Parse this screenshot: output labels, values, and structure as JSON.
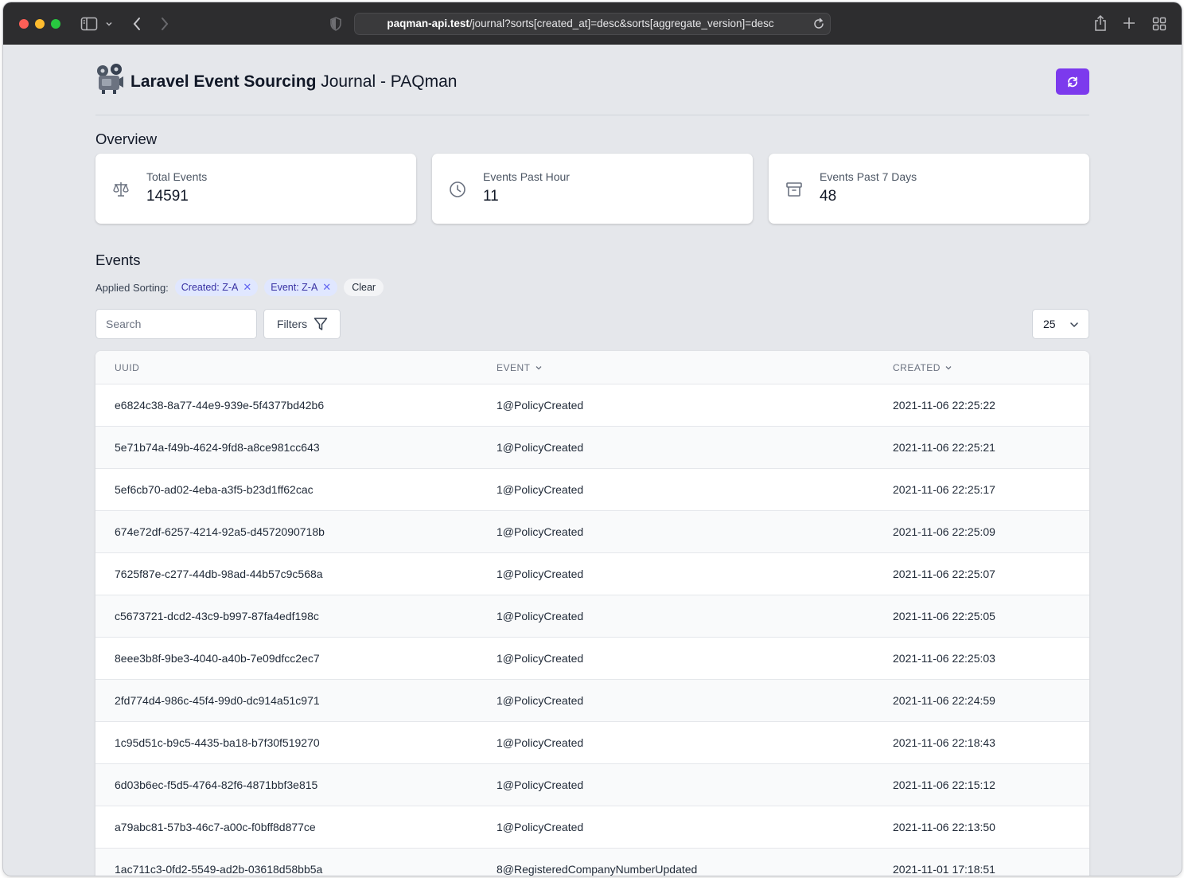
{
  "browser": {
    "url_host": "paqman-api.test",
    "url_path": "/journal?sorts[created_at]=desc&sorts[aggregate_version]=desc"
  },
  "header": {
    "title_strong": "Laravel Event Sourcing",
    "title_rest": " Journal - PAQman",
    "accent_color": "#7c3aed"
  },
  "overview": {
    "title": "Overview",
    "cards": [
      {
        "label": "Total Events",
        "value": "14591",
        "icon": "scale-icon"
      },
      {
        "label": "Events Past Hour",
        "value": "11",
        "icon": "clock-icon"
      },
      {
        "label": "Events Past 7 Days",
        "value": "48",
        "icon": "archive-icon"
      }
    ]
  },
  "events": {
    "title": "Events",
    "sorting_label": "Applied Sorting:",
    "chips": [
      "Created: Z-A",
      "Event: Z-A"
    ],
    "clear_label": "Clear",
    "search_placeholder": "Search",
    "filters_label": "Filters",
    "per_page": "25",
    "columns": [
      "UUID",
      "EVENT",
      "CREATED"
    ],
    "rows": [
      {
        "uuid": "e6824c38-8a77-44e9-939e-5f4377bd42b6",
        "event": "1@PolicyCreated",
        "created": "2021-11-06 22:25:22"
      },
      {
        "uuid": "5e71b74a-f49b-4624-9fd8-a8ce981cc643",
        "event": "1@PolicyCreated",
        "created": "2021-11-06 22:25:21"
      },
      {
        "uuid": "5ef6cb70-ad02-4eba-a3f5-b23d1ff62cac",
        "event": "1@PolicyCreated",
        "created": "2021-11-06 22:25:17"
      },
      {
        "uuid": "674e72df-6257-4214-92a5-d4572090718b",
        "event": "1@PolicyCreated",
        "created": "2021-11-06 22:25:09"
      },
      {
        "uuid": "7625f87e-c277-44db-98ad-44b57c9c568a",
        "event": "1@PolicyCreated",
        "created": "2021-11-06 22:25:07"
      },
      {
        "uuid": "c5673721-dcd2-43c9-b997-87fa4edf198c",
        "event": "1@PolicyCreated",
        "created": "2021-11-06 22:25:05"
      },
      {
        "uuid": "8eee3b8f-9be3-4040-a40b-7e09dfcc2ec7",
        "event": "1@PolicyCreated",
        "created": "2021-11-06 22:25:03"
      },
      {
        "uuid": "2fd774d4-986c-45f4-99d0-dc914a51c971",
        "event": "1@PolicyCreated",
        "created": "2021-11-06 22:24:59"
      },
      {
        "uuid": "1c95d51c-b9c5-4435-ba18-b7f30f519270",
        "event": "1@PolicyCreated",
        "created": "2021-11-06 22:18:43"
      },
      {
        "uuid": "6d03b6ec-f5d5-4764-82f6-4871bbf3e815",
        "event": "1@PolicyCreated",
        "created": "2021-11-06 22:15:12"
      },
      {
        "uuid": "a79abc81-57b3-46c7-a00c-f0bff8d877ce",
        "event": "1@PolicyCreated",
        "created": "2021-11-06 22:13:50"
      },
      {
        "uuid": "1ac711c3-0fd2-5549-ad2b-03618d58bb5a",
        "event": "8@RegisteredCompanyNumberUpdated",
        "created": "2021-11-01 17:18:51"
      }
    ]
  }
}
